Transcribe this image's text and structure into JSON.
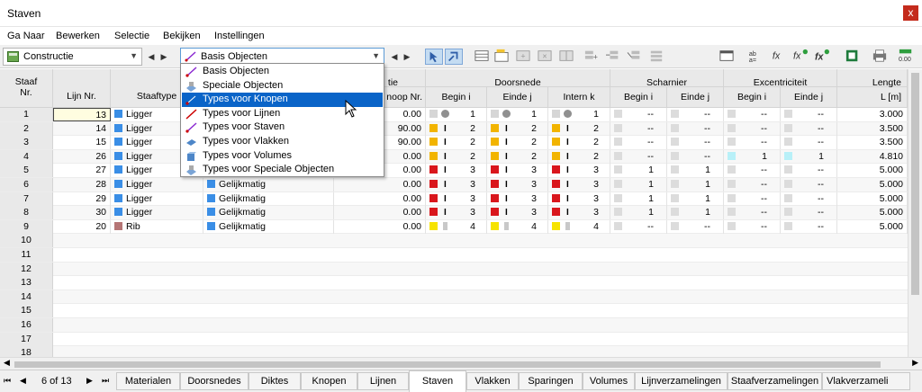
{
  "window": {
    "title": "Staven",
    "close_glyph": "x"
  },
  "menu": [
    "Ga Naar",
    "Bewerken",
    "Selectie",
    "Bekijken",
    "Instellingen"
  ],
  "toolbar": {
    "nav_combo": {
      "value": "Constructie",
      "icon": "structure-icon"
    },
    "type_combo": {
      "value": "Basis Objecten",
      "icon": "member-icon"
    },
    "tool_icons": [
      "select-arrow-icon",
      "select-arrow2-icon",
      "table-icon",
      "table-add-icon",
      "table-copy-icon",
      "table-delete-icon",
      "table-grid-icon",
      "insert-rows-icon",
      "delete-rows-icon",
      "move-rows-icon",
      "sort-icon",
      "panel-icon",
      "sort-az-icon",
      "fx-icon",
      "fx-edit-icon",
      "fx-cond-icon",
      "excel-icon",
      "print-icon",
      "units-icon"
    ]
  },
  "dropdown": {
    "items": [
      {
        "label": "Basis Objecten",
        "icon": "basic-objects-icon",
        "highlighted": false
      },
      {
        "label": "Speciale Objecten",
        "icon": "special-objects-icon",
        "highlighted": false
      },
      {
        "label": "Types voor Knopen",
        "icon": "node-types-icon",
        "highlighted": true
      },
      {
        "label": "Types voor Lijnen",
        "icon": "line-types-icon",
        "highlighted": false
      },
      {
        "label": "Types voor Staven",
        "icon": "member-types-icon",
        "highlighted": false
      },
      {
        "label": "Types voor Vlakken",
        "icon": "surface-types-icon",
        "highlighted": false
      },
      {
        "label": "Types voor Volumes",
        "icon": "solid-types-icon",
        "highlighted": false
      },
      {
        "label": "Types voor Speciale Objecten",
        "icon": "special-types-icon",
        "highlighted": false
      }
    ]
  },
  "table": {
    "group_headers": {
      "positie": "tie",
      "doorsnede": "Doorsnede",
      "scharnier": "Scharnier",
      "excentriciteit": "Excentriciteit",
      "lengte": "Lengte"
    },
    "headers": {
      "staaf_nr_1": "Staaf",
      "staaf_nr_2": "Nr.",
      "lijn_nr": "Lijn Nr.",
      "staaftype": "Staaftype",
      "knoop_nr": "noop Nr.",
      "begin_i": "Begin i",
      "einde_j": "Einde j",
      "intern_k": "Intern k",
      "sch_begin": "Begin i",
      "sch_einde": "Einde j",
      "exc_begin": "Begin i",
      "exc_einde": "Einde j",
      "lengte_unit": "L [m]"
    },
    "rows": [
      {
        "nr": "1",
        "lijn": "13",
        "type": "Ligger",
        "type_color": "#3a8ee6",
        "dist": "",
        "pos": "0.00",
        "ci": "1",
        "cj": "1",
        "ck": "1",
        "cs_color": "#9a9a9a",
        "si": "--",
        "sj": "--",
        "ei": "--",
        "ej": "--",
        "l": "3.000"
      },
      {
        "nr": "2",
        "lijn": "14",
        "type": "Ligger",
        "type_color": "#3a8ee6",
        "dist": "",
        "pos": "90.00",
        "ci": "2",
        "cj": "2",
        "ck": "2",
        "cs_color": "#f2b400",
        "si": "--",
        "sj": "--",
        "ei": "--",
        "ej": "--",
        "l": "3.500"
      },
      {
        "nr": "3",
        "lijn": "15",
        "type": "Ligger",
        "type_color": "#3a8ee6",
        "dist": "",
        "pos": "90.00",
        "ci": "2",
        "cj": "2",
        "ck": "2",
        "cs_color": "#f2b400",
        "si": "--",
        "sj": "--",
        "ei": "--",
        "ej": "--",
        "l": "3.500"
      },
      {
        "nr": "4",
        "lijn": "26",
        "type": "Ligger",
        "type_color": "#3a8ee6",
        "dist": "",
        "pos": "0.00",
        "ci": "2",
        "cj": "2",
        "ck": "2",
        "cs_color": "#f2b400",
        "si": "--",
        "sj": "--",
        "ei": "1",
        "ej": "1",
        "l": "4.810"
      },
      {
        "nr": "5",
        "lijn": "27",
        "type": "Ligger",
        "type_color": "#3a8ee6",
        "dist": "",
        "pos": "0.00",
        "ci": "3",
        "cj": "3",
        "ck": "3",
        "cs_color": "#d9161c",
        "si": "1",
        "sj": "1",
        "ei": "--",
        "ej": "--",
        "l": "5.000"
      },
      {
        "nr": "6",
        "lijn": "28",
        "type": "Ligger",
        "type_color": "#3a8ee6",
        "dist": "Gelijkmatig",
        "pos": "0.00",
        "ci": "3",
        "cj": "3",
        "ck": "3",
        "cs_color": "#d9161c",
        "si": "1",
        "sj": "1",
        "ei": "--",
        "ej": "--",
        "l": "5.000"
      },
      {
        "nr": "7",
        "lijn": "29",
        "type": "Ligger",
        "type_color": "#3a8ee6",
        "dist": "Gelijkmatig",
        "pos": "0.00",
        "ci": "3",
        "cj": "3",
        "ck": "3",
        "cs_color": "#d9161c",
        "si": "1",
        "sj": "1",
        "ei": "--",
        "ej": "--",
        "l": "5.000"
      },
      {
        "nr": "8",
        "lijn": "30",
        "type": "Ligger",
        "type_color": "#3a8ee6",
        "dist": "Gelijkmatig",
        "pos": "0.00",
        "ci": "3",
        "cj": "3",
        "ck": "3",
        "cs_color": "#d9161c",
        "si": "1",
        "sj": "1",
        "ei": "--",
        "ej": "--",
        "l": "5.000"
      },
      {
        "nr": "9",
        "lijn": "20",
        "type": "Rib",
        "type_color": "#b57575",
        "dist": "Gelijkmatig",
        "pos": "0.00",
        "ci": "4",
        "cj": "4",
        "ck": "4",
        "cs_color": "#f6e300",
        "si": "--",
        "sj": "--",
        "ei": "--",
        "ej": "--",
        "l": "5.000"
      }
    ],
    "empty_rows": [
      "10",
      "11",
      "12",
      "13",
      "14",
      "15",
      "16",
      "17",
      "18"
    ]
  },
  "tabs": {
    "page_indicator": "6 of 13",
    "items": [
      "Materialen",
      "Doorsnedes",
      "Diktes",
      "Knopen",
      "Lijnen",
      "Staven",
      "Vlakken",
      "Sparingen",
      "Volumes",
      "Lijnverzamelingen",
      "Staafverzamelingen",
      "Vlakverzameli"
    ],
    "active": "Staven"
  }
}
